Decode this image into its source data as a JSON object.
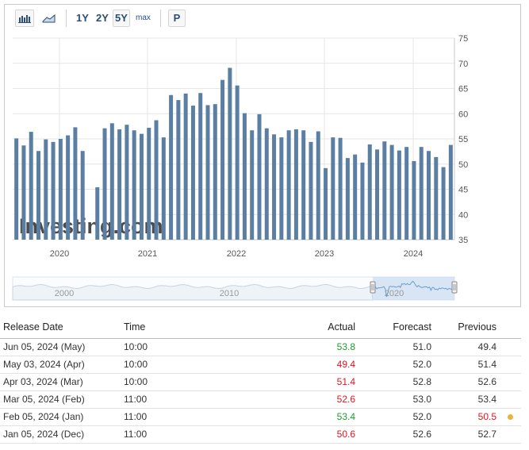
{
  "toolbar": {
    "range_buttons": [
      "1Y",
      "2Y",
      "5Y"
    ],
    "max_label": "max",
    "p_label": "P",
    "active_range": "5Y"
  },
  "watermark": "Investing.com",
  "colors": {
    "bar": "#5b7ea3",
    "navigator_fill": "#c8dcef",
    "navigator_line": "#6b9fcf",
    "positive": "#1f9d2b",
    "negative": "#e0141e",
    "indicator": "#e8b43a"
  },
  "chart_data": {
    "type": "bar",
    "x_tick_labels": [
      "2020",
      "2021",
      "2022",
      "2023",
      "2024"
    ],
    "y_tick_labels": [
      "35",
      "40",
      "45",
      "50",
      "55",
      "60",
      "65",
      "70",
      "75"
    ],
    "ylim": [
      35,
      75
    ],
    "values": [
      55.1,
      53.7,
      56.4,
      52.6,
      54.9,
      54.4,
      55.0,
      55.7,
      57.3,
      52.6,
      35.0,
      45.4,
      57.1,
      58.1,
      56.9,
      57.8,
      56.7,
      56.0,
      57.2,
      58.7,
      55.3,
      63.7,
      62.7,
      64.0,
      61.6,
      64.1,
      61.7,
      61.9,
      66.7,
      69.1,
      65.6,
      60.1,
      56.7,
      59.9,
      57.1,
      55.9,
      55.3,
      56.7,
      56.9,
      56.7,
      54.4,
      56.5,
      49.2,
      55.3,
      55.2,
      51.2,
      51.9,
      50.3,
      53.9,
      52.9,
      54.5,
      53.8,
      52.7,
      53.4,
      50.6,
      53.4,
      52.6,
      51.4,
      49.4,
      53.8
    ],
    "grid": true
  },
  "navigator": {
    "labels": [
      "2000",
      "2010",
      "2020"
    ]
  },
  "table": {
    "headers": [
      "Release Date",
      "Time",
      "Actual",
      "Forecast",
      "Previous"
    ],
    "rows": [
      {
        "date": "Jun 05, 2024 (May)",
        "time": "10:00",
        "actual": "53.8",
        "actual_color": "green",
        "forecast": "51.0",
        "previous": "49.4",
        "previous_color": "",
        "indicator": false
      },
      {
        "date": "May 03, 2024 (Apr)",
        "time": "10:00",
        "actual": "49.4",
        "actual_color": "red",
        "forecast": "52.0",
        "previous": "51.4",
        "previous_color": "",
        "indicator": false
      },
      {
        "date": "Apr 03, 2024 (Mar)",
        "time": "10:00",
        "actual": "51.4",
        "actual_color": "red",
        "forecast": "52.8",
        "previous": "52.6",
        "previous_color": "",
        "indicator": false
      },
      {
        "date": "Mar 05, 2024 (Feb)",
        "time": "11:00",
        "actual": "52.6",
        "actual_color": "red",
        "forecast": "53.0",
        "previous": "53.4",
        "previous_color": "",
        "indicator": false
      },
      {
        "date": "Feb 05, 2024 (Jan)",
        "time": "11:00",
        "actual": "53.4",
        "actual_color": "green",
        "forecast": "52.0",
        "previous": "50.5",
        "previous_color": "red",
        "indicator": true
      },
      {
        "date": "Jan 05, 2024 (Dec)",
        "time": "11:00",
        "actual": "50.6",
        "actual_color": "red",
        "forecast": "52.6",
        "previous": "52.7",
        "previous_color": "",
        "indicator": false
      }
    ]
  }
}
